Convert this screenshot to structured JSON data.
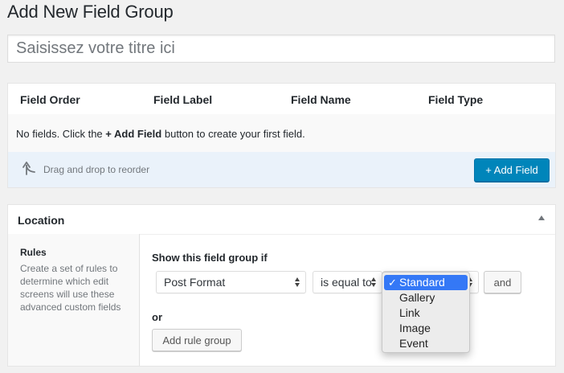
{
  "page": {
    "title": "Add New Field Group"
  },
  "title_input": {
    "placeholder": "Saisissez votre titre ici"
  },
  "fields": {
    "columns": [
      "Field Order",
      "Field Label",
      "Field Name",
      "Field Type"
    ],
    "empty": {
      "prefix": "No fields. Click the",
      "link": "+ Add Field",
      "suffix": "button to create your first field."
    },
    "footer": {
      "drag_hint": "Drag and drop to reorder",
      "add_button": "+ Add Field"
    }
  },
  "location": {
    "title": "Location",
    "rules": {
      "label": "Rules",
      "description": "Create a set of rules to determine which edit screens will use these advanced custom fields"
    },
    "show_if": "Show this field group if",
    "rule": {
      "param": "Post Format",
      "operator": "is equal to",
      "value": "Standard"
    },
    "and_button": "and",
    "or_label": "or",
    "add_group_button": "Add rule group"
  },
  "dropdown": {
    "check": "✓",
    "selected": "Standard",
    "options": [
      "Standard",
      "Gallery",
      "Link",
      "Image",
      "Event"
    ]
  }
}
